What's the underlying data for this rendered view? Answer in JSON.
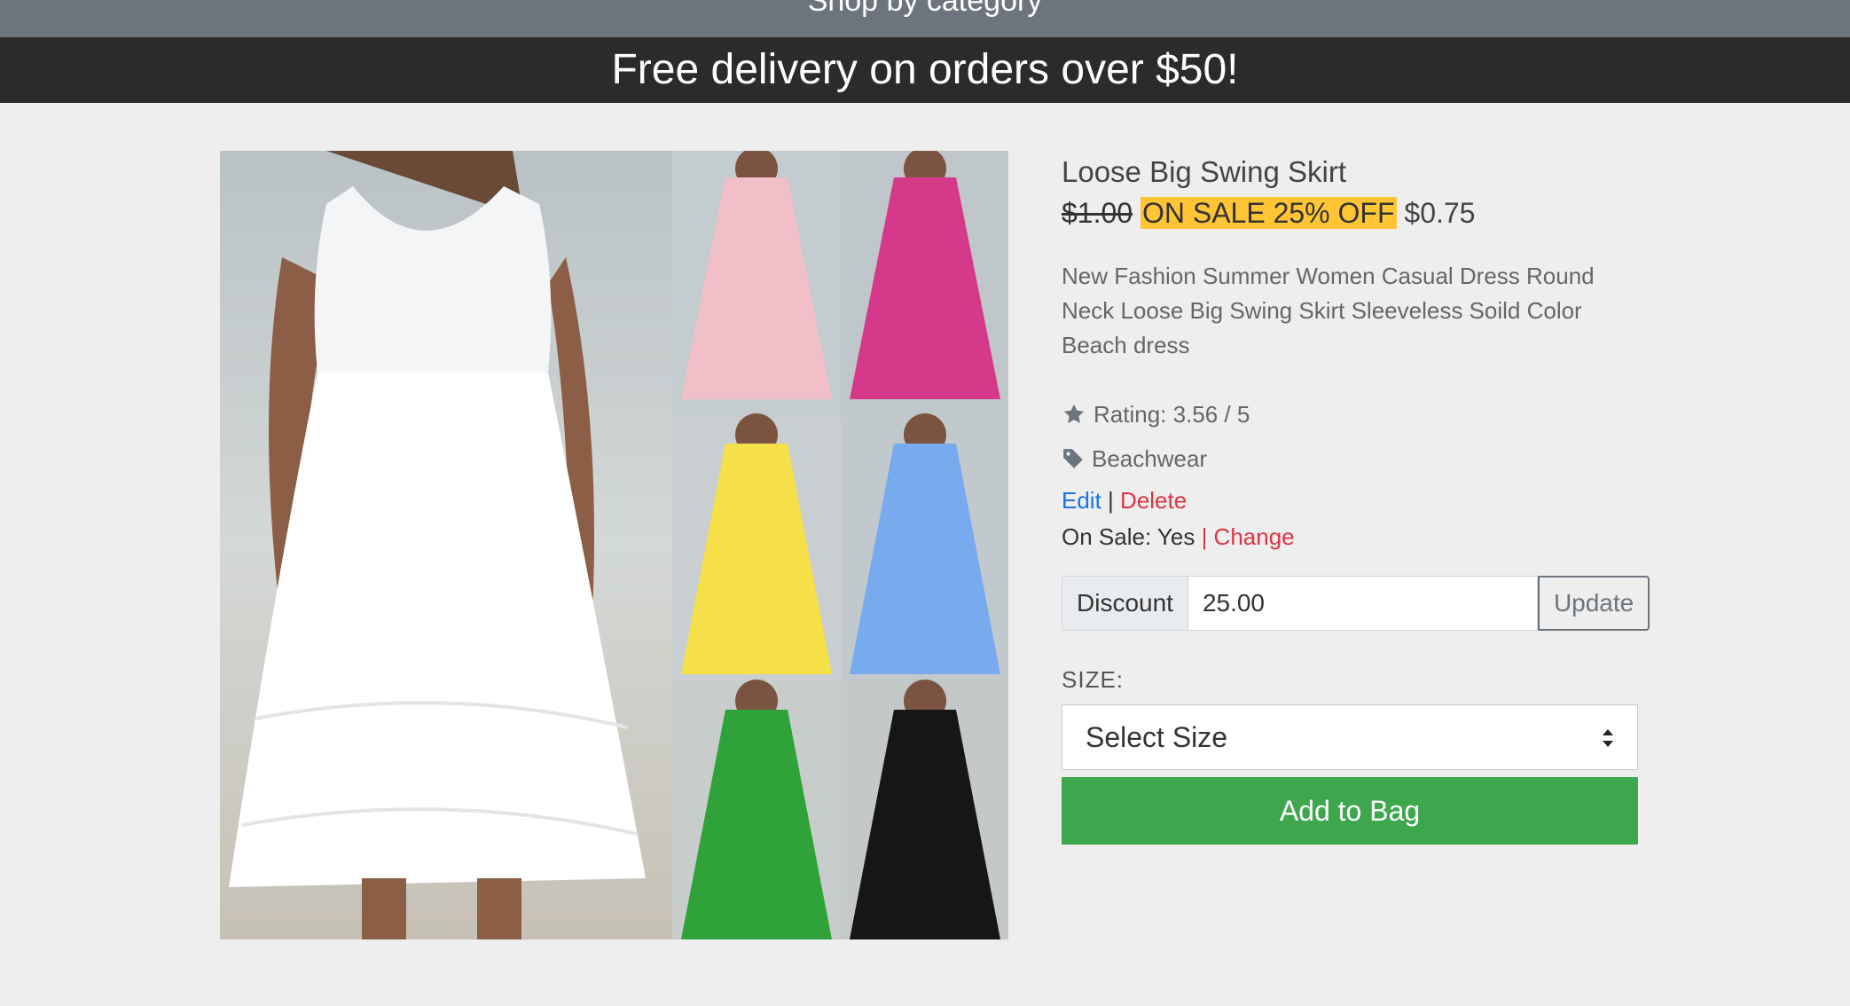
{
  "top_bar": {
    "partial_text": "Shop by category"
  },
  "banner": {
    "text": "Free delivery on orders over $50!"
  },
  "product": {
    "image_alt": "Product photo: white, pink, magenta, yellow, blue, green and black swing dresses",
    "title": "Loose Big Swing Skirt",
    "old_price": "$1.00",
    "sale_badge": "ON SALE 25% OFF",
    "new_price": "$0.75",
    "description": "New Fashion Summer Women Casual Dress Round Neck Loose Big Swing Skirt Sleeveless Soild Color Beach dress",
    "rating_text": "Rating: 3.56 / 5",
    "category": "Beachwear",
    "edit_label": "Edit",
    "separator": "|",
    "delete_label": "Delete",
    "on_sale_text": "On Sale: Yes",
    "change_label": "| Change",
    "discount_label": "Discount",
    "discount_value": "25.00",
    "update_label": "Update",
    "size_label": "SIZE:",
    "size_select_value": "Select Size",
    "add_to_bag_label": "Add to Bag"
  },
  "icons": {
    "rating": "star-icon",
    "category": "tag-icon",
    "select": "sort-arrows-icon"
  },
  "colors": {
    "banner_bg": "#2b2b2b",
    "sale_badge_bg": "#ffc535",
    "add_to_bag_bg": "#3ea74e",
    "edit_link": "#1a73e8",
    "delete_link": "#dc3545"
  }
}
